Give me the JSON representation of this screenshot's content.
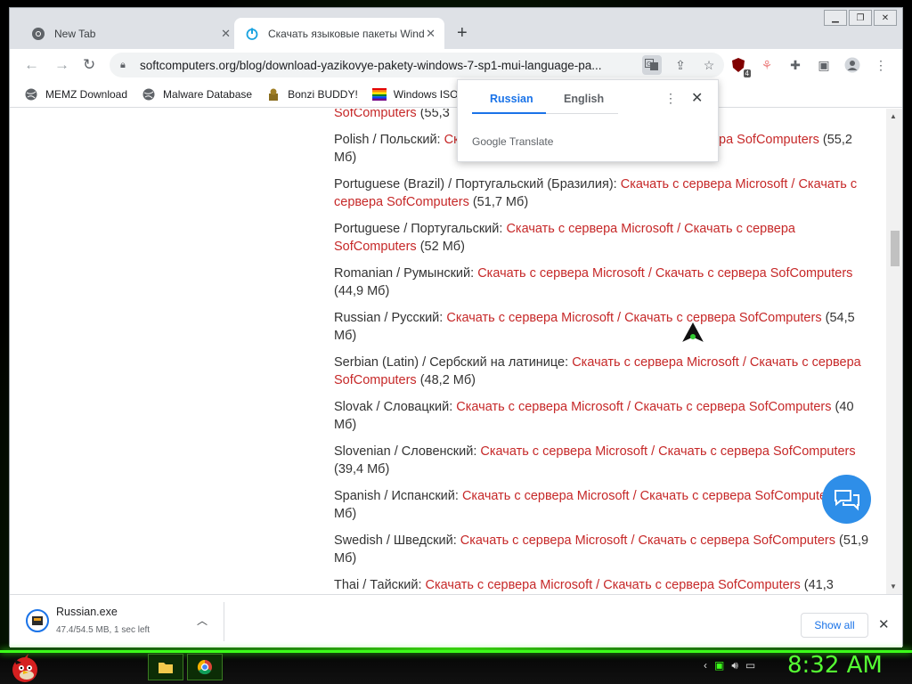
{
  "tabs": [
    {
      "title": "New Tab",
      "icon": "chrome-icon"
    },
    {
      "title": "Скачать языковые пакеты Wind",
      "icon": "power-icon"
    }
  ],
  "toolbar": {
    "url": "softcomputers.org/blog/download-yazikovye-pakety-windows-7-sp1-mui-language-pa...",
    "extension_badge": "4"
  },
  "bookmarks": [
    {
      "label": "MEMZ Download",
      "icon": "globe-icon"
    },
    {
      "label": "Malware Database",
      "icon": "globe-icon"
    },
    {
      "label": "Bonzi BUDDY!",
      "icon": "bonzi-icon"
    },
    {
      "label": "Windows ISOs",
      "icon": "rainbow-flag-icon"
    }
  ],
  "translate_popup": {
    "lang_source": "Russian",
    "lang_target": "English",
    "brand": "Google Translate"
  },
  "languages": [
    {
      "name": "",
      "ms": "",
      "sep": "",
      "sc": "SofComputers",
      "size": " (55,3"
    },
    {
      "name": "Polish / Польский: ",
      "ms": "Скачать с сервера Microsoft",
      "sep": " / ",
      "sc": "Скачать с сервера SofComputers",
      "size": " (55,2 Мб)"
    },
    {
      "name": "Portuguese (Brazil) / Португальский (Бразилия): ",
      "ms": "Скачать с сервера Microsoft",
      "sep": " / ",
      "sc": "Скачать с сервера SofComputers",
      "size": " (51,7 Мб)"
    },
    {
      "name": "Portuguese / Португальский: ",
      "ms": "Скачать с сервера Microsoft",
      "sep": " / ",
      "sc": "Скачать с сервера SofComputers",
      "size": " (52 Мб)"
    },
    {
      "name": "Romanian / Румынский: ",
      "ms": "Скачать с сервера Microsoft",
      "sep": " / ",
      "sc": "Скачать с сервера SofComputers",
      "size": " (44,9 Мб)"
    },
    {
      "name": "Russian / Русский: ",
      "ms": "Скачать с сервера Microsoft",
      "sep": " / ",
      "sc": "Скачать с сервера SofComputers",
      "size": " (54,5 Мб)"
    },
    {
      "name": "Serbian (Latin) / Сербский на латинице: ",
      "ms": "Скачать с сервера Microsoft",
      "sep": " / ",
      "sc": "Скачать с сервера SofComputers",
      "size": " (48,2 Мб)"
    },
    {
      "name": "Slovak / Словацкий: ",
      "ms": "Скачать с сервера Microsoft",
      "sep": " / ",
      "sc": "Скачать с сервера SofComputers",
      "size": " (40 Мб)"
    },
    {
      "name": "Slovenian / Словенский: ",
      "ms": "Скачать с сервера Microsoft",
      "sep": " / ",
      "sc": "Скачать с сервера SofComputers",
      "size": " (39,4 Мб)"
    },
    {
      "name": "Spanish / Испанский: ",
      "ms": "Скачать с сервера Microsoft",
      "sep": " / ",
      "sc": "Скачать с сервера SofComputers",
      "size": " (97,5 Мб)"
    },
    {
      "name": "Swedish / Шведский: ",
      "ms": "Скачать с сервера Microsoft",
      "sep": " / ",
      "sc": "Скачать с сервера SofComputers",
      "size": " (51,9 Мб)"
    },
    {
      "name": "Thai / Тайский: ",
      "ms": "Скачать с сервера Microsoft",
      "sep": " / ",
      "sc": "Скачать с сервера SofComputers",
      "size": " (41,3"
    }
  ],
  "download": {
    "filename": "Russian.exe",
    "status": "47.4/54.5 MB, 1 sec left",
    "show_all": "Show all"
  },
  "taskbar": {
    "clock": "8:32 AM"
  },
  "colors": {
    "link": "#c62828",
    "accent": "#1a73e8",
    "clock": "#55ff33",
    "chat": "#2e8ee8"
  }
}
